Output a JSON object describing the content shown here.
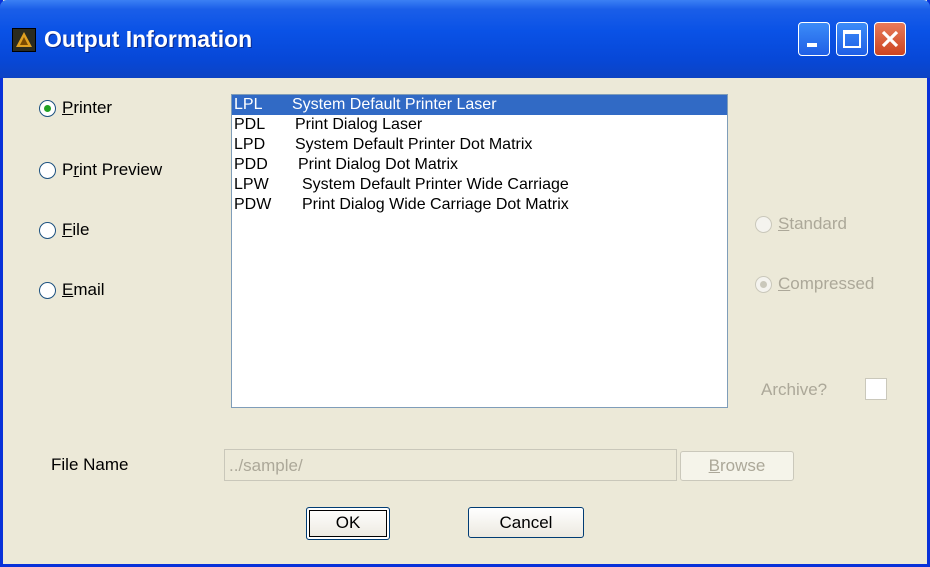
{
  "window": {
    "title": "Output Information"
  },
  "output_options": [
    {
      "label_accel": "P",
      "label_rest": "rinter",
      "checked": true
    },
    {
      "label_accel": "P",
      "label_rest": "rint Preview",
      "checked": false
    },
    {
      "label_accel": "F",
      "label_rest": "ile",
      "checked": false
    },
    {
      "label_accel": "E",
      "label_rest": "mail",
      "checked": false
    }
  ],
  "printers": [
    {
      "code": "LPL",
      "desc": "System Default Printer Laser",
      "selected": true
    },
    {
      "code": "PDL",
      "desc": "Print Dialog Laser",
      "selected": false
    },
    {
      "code": "LPD",
      "desc": "System Default Printer Dot Matrix",
      "selected": false
    },
    {
      "code": "PDD",
      "desc": "Print Dialog Dot Matrix",
      "selected": false
    },
    {
      "code": "LPW",
      "desc": "System Default Printer Wide Carriage",
      "selected": false
    },
    {
      "code": "PDW",
      "desc": "Print Dialog Wide Carriage Dot Matrix",
      "selected": false
    }
  ],
  "format_options": [
    {
      "label_accel": "S",
      "label_rest": "tandard",
      "checked": false
    },
    {
      "label_accel": "C",
      "label_rest": "ompressed",
      "checked": true
    }
  ],
  "archive": {
    "label": "Archive?"
  },
  "file": {
    "label": "File Name",
    "value": "../sample/",
    "browse_accel": "B",
    "browse_rest": "rowse"
  },
  "actions": {
    "ok_label": "OK",
    "cancel_label": "Cancel"
  },
  "colors": {
    "titlebar": "#0a52e6",
    "selection": "#316ac5",
    "dialog_bg": "#ece9d8"
  }
}
